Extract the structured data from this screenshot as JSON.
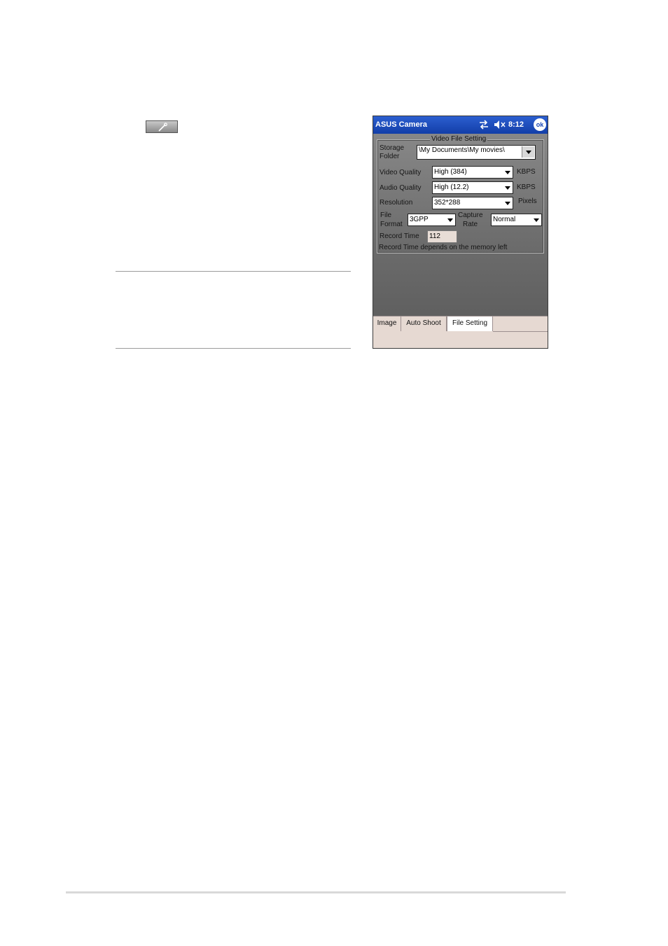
{
  "window": {
    "title": "ASUS Camera",
    "clock": "8:12",
    "ok_label": "ok"
  },
  "group_title": "Video File Setting",
  "settings": {
    "storage_label_1": "Storage",
    "storage_label_2": "Folder",
    "storage_value": "\\My Documents\\My movies\\",
    "video_quality_label": "Video Quality",
    "video_quality_value": "High (384)",
    "video_quality_unit": "KBPS",
    "audio_quality_label": "Audio Quality",
    "audio_quality_value": "High (12.2)",
    "audio_quality_unit": "KBPS",
    "resolution_label": "Resolution",
    "resolution_value": "352*288",
    "resolution_unit": "Pixels",
    "file_format_label_1": "File",
    "file_format_label_2": "Format",
    "file_format_value": "3GPP",
    "capture_rate_label_1": "Capture",
    "capture_rate_label_2": "Rate",
    "capture_rate_value": "Normal",
    "record_time_label": "Record Time",
    "record_time_value": "112",
    "note": "Record Time depends on the memory left"
  },
  "tabs": [
    {
      "label": "Image"
    },
    {
      "label": "Auto Shoot"
    },
    {
      "label": "File Setting"
    }
  ],
  "icons": {
    "toolbar": "wrench-icon",
    "sync": "sync-icon",
    "speaker": "speaker-muted-icon"
  },
  "colors": {
    "titlebar": "#1846b5",
    "tabbar": "#e6d9d2"
  }
}
